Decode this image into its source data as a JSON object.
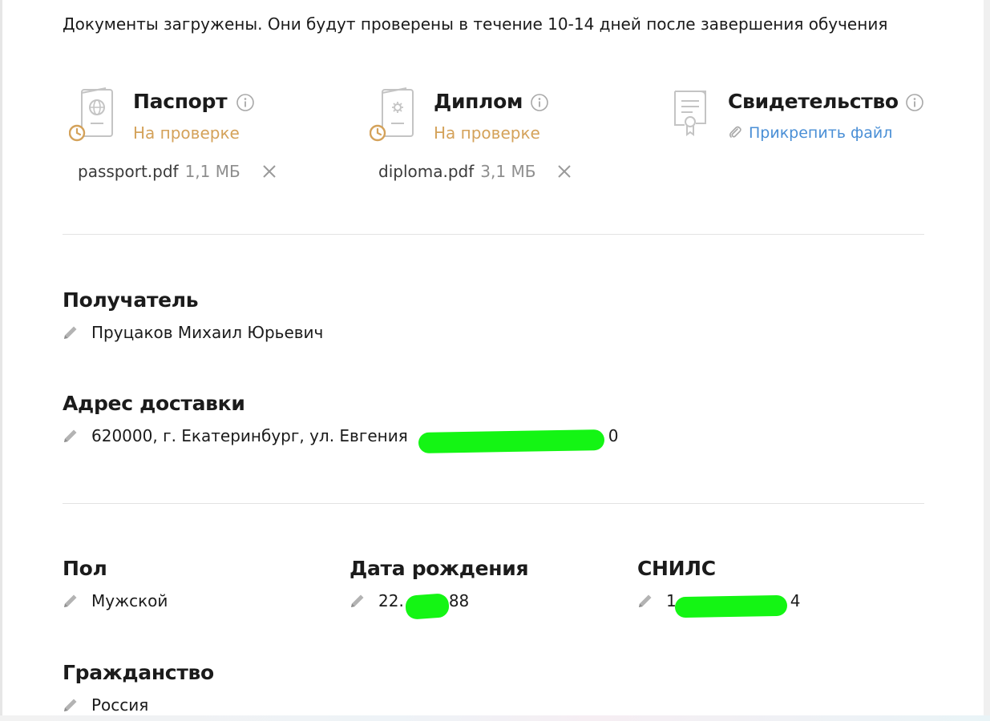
{
  "notice": "Документы загружены. Они будут проверены в течение 10-14 дней после завершения обучения",
  "documents": [
    {
      "title": "Паспорт",
      "status": "На проверке",
      "file_name": "passport.pdf",
      "file_size": "1,1 МБ",
      "icon": "passport-icon"
    },
    {
      "title": "Диплом",
      "status": "На проверке",
      "file_name": "diploma.pdf",
      "file_size": "3,1 МБ",
      "icon": "diploma-icon"
    },
    {
      "title": "Свидетельство",
      "attach_label": "Прикрепить файл",
      "icon": "certificate-icon"
    }
  ],
  "recipient": {
    "label": "Получатель",
    "value": "Пруцаков Михаил Юрьевич"
  },
  "address": {
    "label": "Адрес доставки",
    "value": "620000, г. Екатеринбург, ул. Евгения",
    "value_tail": "0"
  },
  "gender": {
    "label": "Пол",
    "value": "Мужской"
  },
  "birthdate": {
    "label": "Дата рождения",
    "value": "22.",
    "value_tail": "88"
  },
  "snils": {
    "label": "СНИЛС",
    "value": "1",
    "value_tail": "4"
  },
  "citizenship": {
    "label": "Гражданство",
    "value": "Россия"
  },
  "colors": {
    "pending": "#d4a25a",
    "link": "#4a8fd6",
    "text": "#1b1b1b",
    "redaction": "#14f514"
  }
}
